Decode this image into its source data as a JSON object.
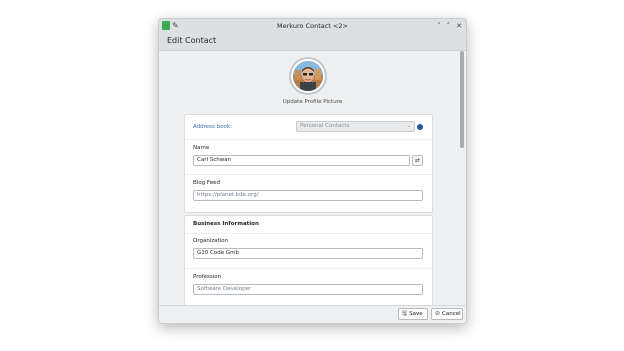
{
  "window": {
    "title": "Merkuro Contact <2>",
    "controls": {
      "minimize": "˅",
      "maximize": "˄",
      "close": "✕"
    },
    "pin_glyph": "✎"
  },
  "header": {
    "title": "Edit Contact"
  },
  "profile": {
    "update_label": "Update Profile Picture"
  },
  "form": {
    "address_book": {
      "label": "Address book:",
      "value": "Personal Contacts",
      "arrow": "⌄"
    },
    "name": {
      "label": "Name",
      "value": "Carl Schwan",
      "swap_glyph": "⇄"
    },
    "blog_feed": {
      "label": "Blog Feed",
      "placeholder": "https://planet.kde.org/"
    },
    "business": {
      "heading": "Business Information",
      "organization": {
        "label": "Organization",
        "value": "G10 Code Gmb"
      },
      "profession": {
        "label": "Profession",
        "placeholder": "Software Developer"
      }
    }
  },
  "footer": {
    "save": {
      "label": "Save",
      "icon_glyph": "🖫"
    },
    "cancel": {
      "label": "Cancel",
      "icon_glyph": "⊘"
    }
  },
  "colors": {
    "accent": "#3071b3",
    "dot": "#1d5aa0",
    "app_icon": "#3daa4f"
  }
}
